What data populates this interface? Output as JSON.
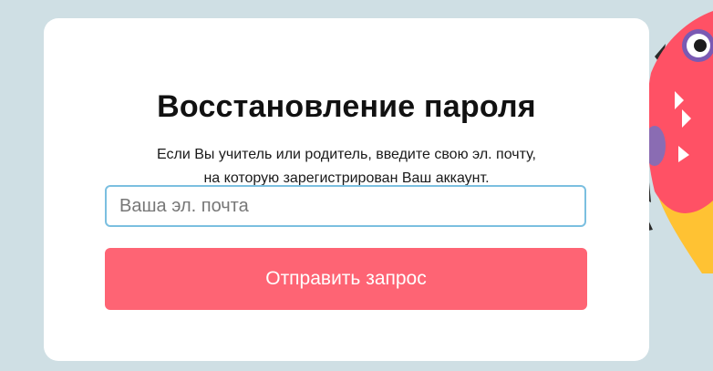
{
  "recovery": {
    "title": "Восстановление пароля",
    "description_line1": "Если Вы учитель или родитель, введите свою эл. почту,",
    "description_line2": "на которую зарегистрирован Ваш аккаунт.",
    "email_placeholder": "Ваша эл. почта",
    "email_value": "",
    "submit_label": "Отправить запрос"
  },
  "colors": {
    "background": "#cfdfe4",
    "card": "#ffffff",
    "input_border": "#7bbfe0",
    "button": "#fe6474",
    "button_text": "#ffffff"
  },
  "decor": {
    "mascot": "monster-mascot-illustration"
  }
}
